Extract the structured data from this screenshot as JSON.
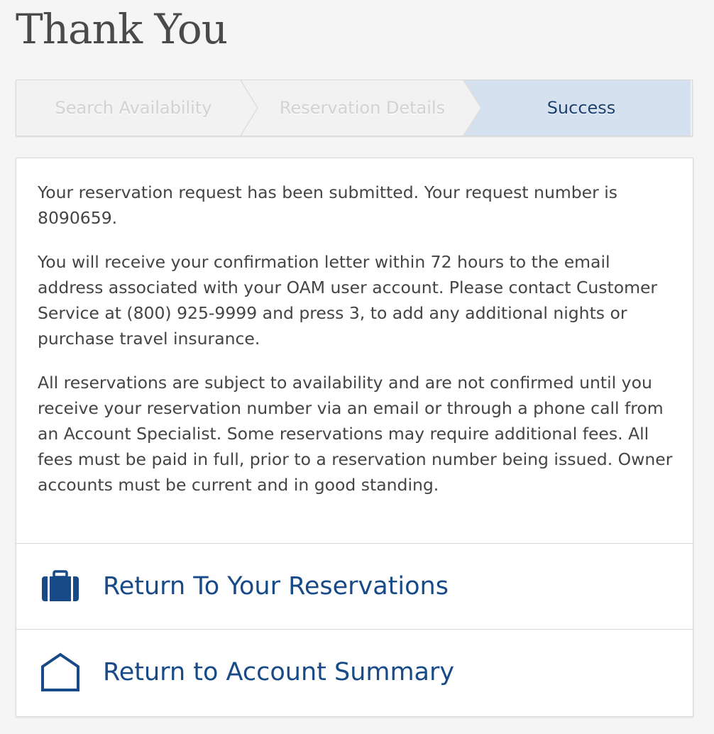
{
  "page": {
    "title": "Thank You"
  },
  "steps": [
    {
      "label": "Search Availability",
      "state": "inactive"
    },
    {
      "label": "Reservation Details",
      "state": "inactive"
    },
    {
      "label": "Success",
      "state": "active"
    }
  ],
  "message": {
    "paragraph_1": "Your reservation request has been submitted. Your request number is 8090659.",
    "paragraph_2": "You will receive your confirmation letter within 72 hours to the email address associated with your OAM user account. Please contact Customer Service at (800) 925-9999 and press 3, to add any additional nights or purchase travel insurance.",
    "paragraph_3": "All reservations are subject to availability and are not confirmed until you receive your reservation number via an email or through a phone call from an Account Specialist. Some reservations may require additional fees. All fees must be paid in full, prior to a reservation number being issued. Owner accounts must be current and in good standing."
  },
  "actions": [
    {
      "label": "Return To Your Reservations",
      "icon": "suitcase-icon"
    },
    {
      "label": "Return to Account Summary",
      "icon": "house-icon"
    }
  ],
  "colors": {
    "accent": "#174a86",
    "active_step_bg": "#d5e1ef",
    "text": "#444444"
  }
}
